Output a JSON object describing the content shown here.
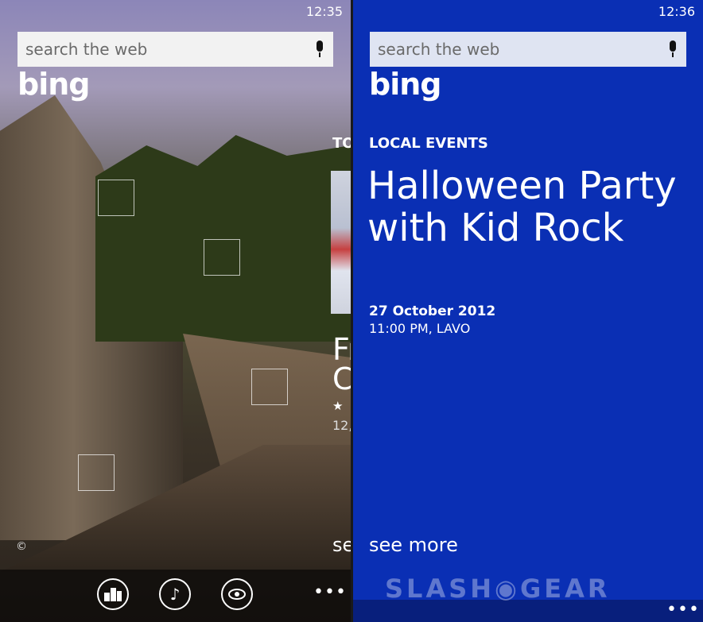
{
  "left_screen": {
    "clock": "12:35",
    "search_placeholder": "search the web",
    "logo": "bing",
    "peek_heading": "TO",
    "peek_title_1": "Fr",
    "peek_title_2": "C",
    "peek_rating": "★",
    "peek_sub": "12,",
    "peek_see": "se",
    "copyright": "©",
    "appbar": {
      "icons": [
        "local-scout-icon",
        "music-icon",
        "vision-icon"
      ],
      "more": "•••"
    }
  },
  "right_screen": {
    "clock": "12:36",
    "search_placeholder": "search the web",
    "logo": "bing",
    "section_label": "LOCAL EVENTS",
    "event_title": "Halloween Party with Kid Rock",
    "event_date": "27 October 2012",
    "event_time_place": "11:00 PM, LAVO",
    "see_more": "see more",
    "more": "•••"
  },
  "watermark": "SLASH◉GEAR",
  "colors": {
    "right_bg": "#0a2fb4",
    "text": "#ffffff"
  }
}
